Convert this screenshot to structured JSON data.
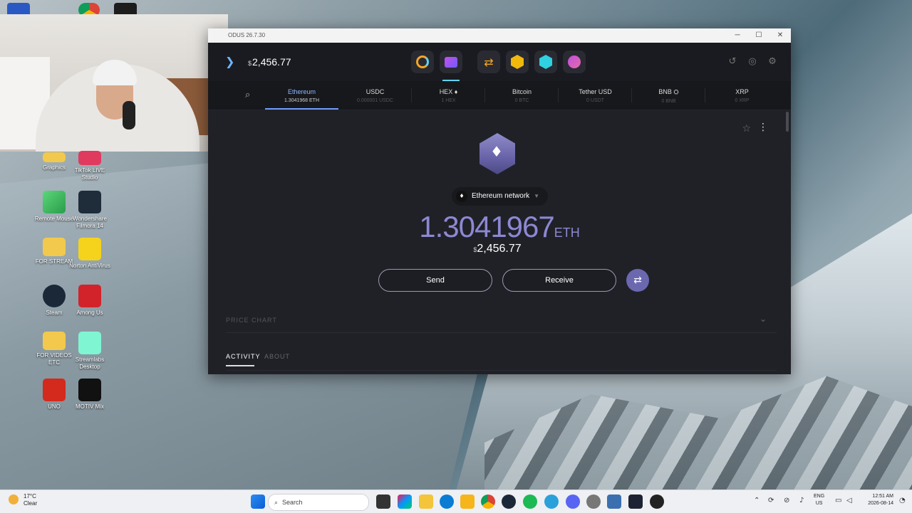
{
  "window": {
    "title": "ODUS 26.7.30"
  },
  "header": {
    "balance_symbol": "$",
    "balance": "2,456.77"
  },
  "assets": [
    {
      "name": "Ethereum",
      "amount": "1.3041968 ETH"
    },
    {
      "name": "USDC",
      "amount": "0.000001 USDC"
    },
    {
      "name": "HEX ♦",
      "amount": "1 HEX"
    },
    {
      "name": "Bitcoin",
      "amount": "0 BTC"
    },
    {
      "name": "Tether USD",
      "amount": "0 USDT"
    },
    {
      "name": "BNB ⛭",
      "amount": "0 BNB"
    },
    {
      "name": "XRP",
      "amount": "0 XRP"
    }
  ],
  "wallet": {
    "network": "Ethereum network",
    "amount": "1.3041967",
    "unit": "ETH",
    "fiat_symbol": "$",
    "fiat": "2,456.77",
    "send_label": "Send",
    "receive_label": "Receive",
    "price_chart_label": "PRICE CHART",
    "tab_activity": "ACTIVITY",
    "tab_about": "ABOUT"
  },
  "desktop_icons": [
    {
      "label": "Graphics"
    },
    {
      "label": "TikTok LIVE Studio"
    },
    {
      "label": "Remote Mouse"
    },
    {
      "label": "Wondershare Filmora 14"
    },
    {
      "label": "FOR STREAM"
    },
    {
      "label": "Norton AntiVirus"
    },
    {
      "label": "Steam"
    },
    {
      "label": "Among Us"
    },
    {
      "label": "FOR VIDEOS ETC"
    },
    {
      "label": "Streamlabs Desktop"
    },
    {
      "label": "UNO"
    },
    {
      "label": "MOTIV Mix"
    }
  ],
  "taskbar": {
    "weather_temp": "17°C",
    "weather_desc": "Clear",
    "search_placeholder": "Search",
    "lang_1": "ENG",
    "lang_2": "US",
    "time": "12:51 AM",
    "date": "2026-08-14"
  },
  "colors": {
    "accent": "#8d88d2",
    "window_bg": "#202127",
    "topbar_bg": "#1a1b20"
  }
}
